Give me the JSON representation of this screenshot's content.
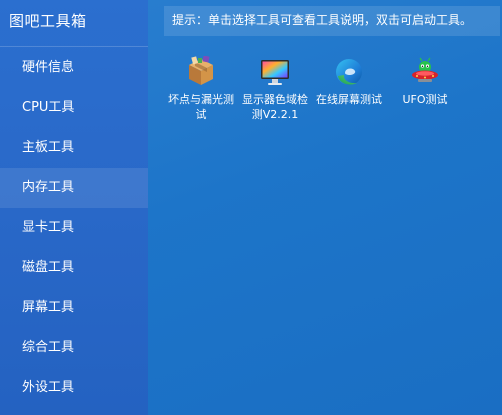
{
  "app": {
    "title": "图吧工具箱"
  },
  "sidebar": {
    "items": [
      {
        "label": "硬件信息",
        "active": false
      },
      {
        "label": "CPU工具",
        "active": false
      },
      {
        "label": "主板工具",
        "active": false
      },
      {
        "label": "内存工具",
        "active": true
      },
      {
        "label": "显卡工具",
        "active": false
      },
      {
        "label": "磁盘工具",
        "active": false
      },
      {
        "label": "屏幕工具",
        "active": false
      },
      {
        "label": "综合工具",
        "active": false
      },
      {
        "label": "外设工具",
        "active": false
      }
    ]
  },
  "hint": {
    "text": "提示：单击选择工具可查看工具说明，双击可启动工具。"
  },
  "tools": [
    {
      "label": "坏点与漏光测试",
      "icon": "package-box-icon"
    },
    {
      "label": "显示器色域检测V2.2.1",
      "icon": "monitor-color-icon"
    },
    {
      "label": "在线屏幕测试",
      "icon": "edge-browser-icon"
    },
    {
      "label": "UFO测试",
      "icon": "ufo-icon"
    }
  ],
  "colors": {
    "background": "#1d75c9",
    "sidebar": "#2968c8",
    "text": "#ffffff"
  }
}
